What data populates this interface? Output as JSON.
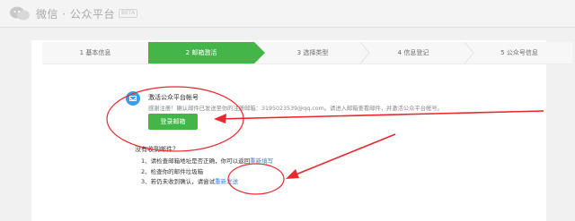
{
  "header": {
    "logo_text": "微信 · 公众平台",
    "beta_tag": "BETA"
  },
  "steps": [
    {
      "label": "1 基本信息"
    },
    {
      "label": "2 邮箱激活"
    },
    {
      "label": "3 选择类型"
    },
    {
      "label": "4 信息登记"
    },
    {
      "label": "5 公众号信息"
    }
  ],
  "activation": {
    "title": "激活公众平台帐号",
    "message": "感谢注册！确认邮件已发送至你的注册邮箱：3195023539@qq.com。请进入邮箱查看邮件，并激活公众平台帐号。",
    "login_button": "登录邮箱"
  },
  "help": {
    "title": "没有收到邮件？",
    "item1_text": "1、请检查邮箱地址是否正确，你可以返回",
    "item1_link": "重新填写",
    "item2_text": "2、检查你的邮件垃圾箱",
    "item3_text": "3、若仍未收到确认，请尝试",
    "item3_link": "重新发送"
  },
  "colors": {
    "accent_green": "#44b549",
    "link_blue": "#3a83d6",
    "annotation_red": "#e8282d"
  }
}
